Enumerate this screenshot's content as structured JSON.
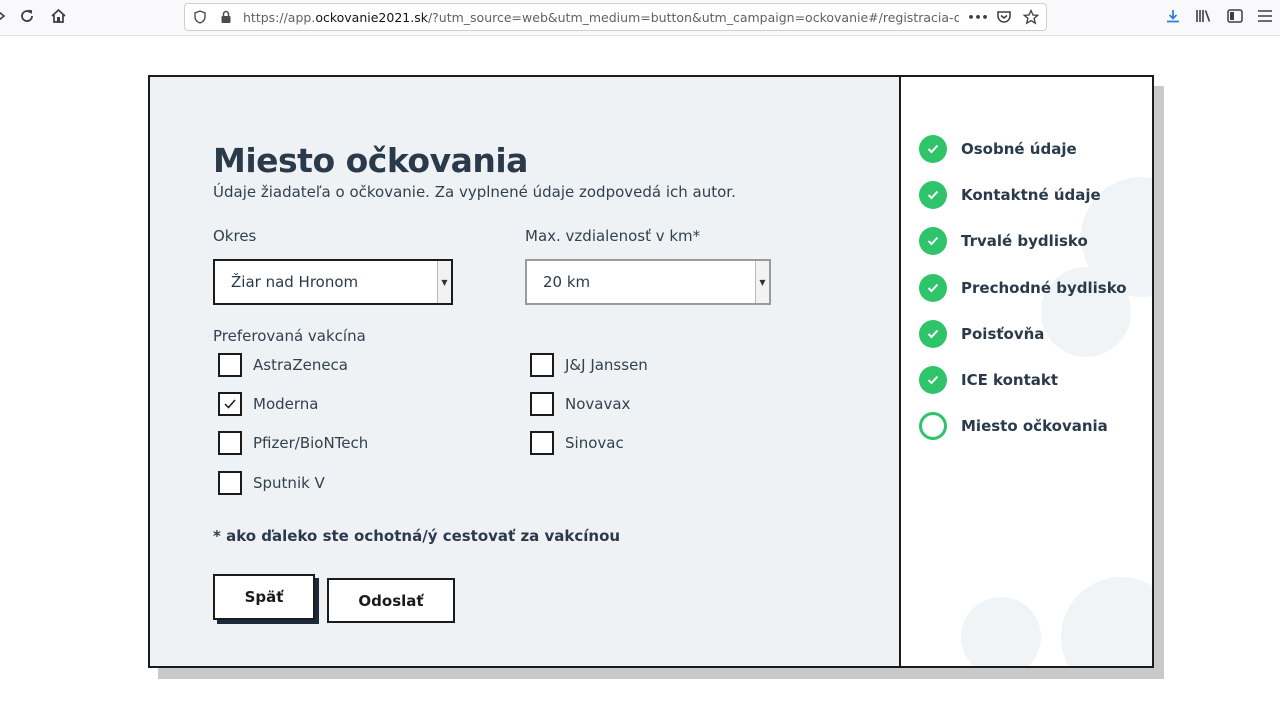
{
  "browser": {
    "url_prefix": "https://app.",
    "url_host": "ockovanie2021.sk",
    "url_rest": "/?utm_source=web&utm_medium=button&utm_campaign=ockovanie#/registracia-oc",
    "more_icon": "•••"
  },
  "form": {
    "title": "Miesto očkovania",
    "subtitle": "Údaje žiadateľa o očkovanie. Za vyplnené údaje zodpovedá ich autor.",
    "okres": {
      "label": "Okres",
      "value": "Žiar nad Hronom"
    },
    "distance": {
      "label": "Max. vzdialenosť v km*",
      "value": "20 km"
    },
    "vaccine_label": "Preferovaná vakcína",
    "vaccines": [
      {
        "label": "AstraZeneca",
        "checked": false
      },
      {
        "label": "J&J Janssen",
        "checked": false
      },
      {
        "label": "Moderna",
        "checked": true
      },
      {
        "label": "Novavax",
        "checked": false
      },
      {
        "label": "Pfizer/BioNTech",
        "checked": false
      },
      {
        "label": "Sinovac",
        "checked": false
      },
      {
        "label": "Sputnik V",
        "checked": false
      }
    ],
    "note": "* ako ďaleko ste ochotná/ý cestovať za vakcínou",
    "back_label": "Späť",
    "submit_label": "Odoslať"
  },
  "steps": [
    {
      "label": "Osobné údaje",
      "done": true
    },
    {
      "label": "Kontaktné údaje",
      "done": true
    },
    {
      "label": "Trvalé bydlisko",
      "done": true
    },
    {
      "label": "Prechodné bydlisko",
      "done": true
    },
    {
      "label": "Poisťovňa",
      "done": true
    },
    {
      "label": "ICE kontakt",
      "done": true
    },
    {
      "label": "Miesto očkovania",
      "done": false
    }
  ],
  "colors": {
    "accent": "#2fc36a",
    "text": "#2b3a4a",
    "panel": "#eff2f5",
    "border": "#1b1b1b"
  }
}
